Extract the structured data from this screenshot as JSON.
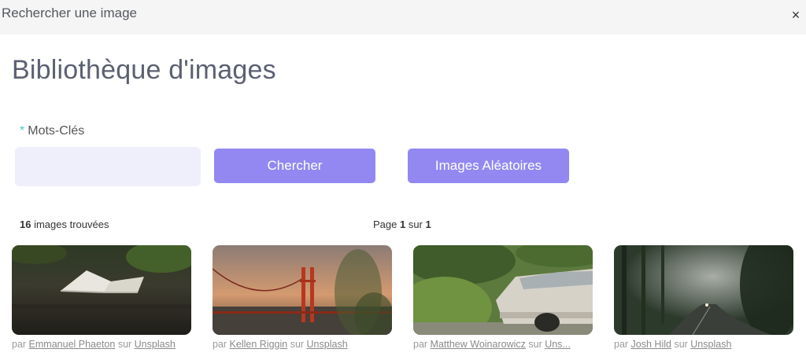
{
  "dialog": {
    "title": "Rechercher une image",
    "close_label": "×"
  },
  "page": {
    "title": "Bibliothèque d'images"
  },
  "search": {
    "required_marker": "*",
    "label": "Mots-Clés",
    "value": "",
    "placeholder": "",
    "search_button": "Chercher",
    "random_button": "Images Aléatoires"
  },
  "results": {
    "count": "16",
    "count_suffix": " images trouvées",
    "page_prefix": "Page ",
    "page_current": "1",
    "page_sep": " sur ",
    "page_total": "1"
  },
  "colors": {
    "accent": "#9388f2",
    "input_bg": "#efeffc",
    "required": "#4fc3c7"
  },
  "images": [
    {
      "by": "par ",
      "author": "Emmanuel Phaeton",
      "on": " sur ",
      "source": "Unsplash"
    },
    {
      "by": "par ",
      "author": "Kellen Riggin",
      "on": " sur ",
      "source": "Unsplash"
    },
    {
      "by": "par ",
      "author": "Matthew Woinarowicz",
      "on": " sur ",
      "source": "Uns..."
    },
    {
      "by": "par ",
      "author": "Josh Hild",
      "on": " sur ",
      "source": "Unsplash"
    }
  ]
}
